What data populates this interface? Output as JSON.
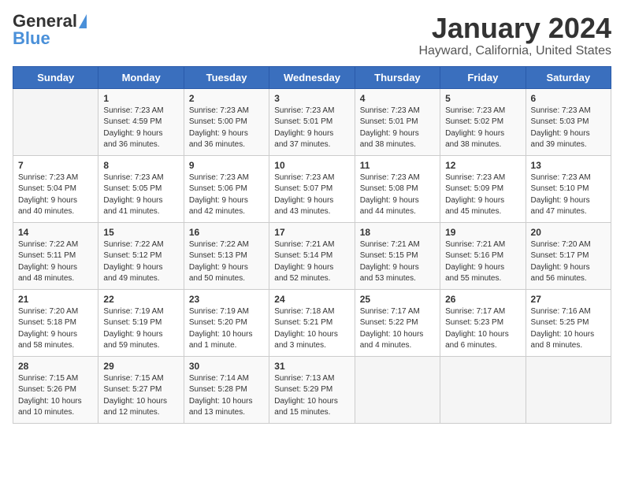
{
  "logo": {
    "general": "General",
    "blue": "Blue"
  },
  "title": "January 2024",
  "subtitle": "Hayward, California, United States",
  "days_header": [
    "Sunday",
    "Monday",
    "Tuesday",
    "Wednesday",
    "Thursday",
    "Friday",
    "Saturday"
  ],
  "weeks": [
    [
      {
        "num": "",
        "info": ""
      },
      {
        "num": "1",
        "info": "Sunrise: 7:23 AM\nSunset: 4:59 PM\nDaylight: 9 hours\nand 36 minutes."
      },
      {
        "num": "2",
        "info": "Sunrise: 7:23 AM\nSunset: 5:00 PM\nDaylight: 9 hours\nand 36 minutes."
      },
      {
        "num": "3",
        "info": "Sunrise: 7:23 AM\nSunset: 5:01 PM\nDaylight: 9 hours\nand 37 minutes."
      },
      {
        "num": "4",
        "info": "Sunrise: 7:23 AM\nSunset: 5:01 PM\nDaylight: 9 hours\nand 38 minutes."
      },
      {
        "num": "5",
        "info": "Sunrise: 7:23 AM\nSunset: 5:02 PM\nDaylight: 9 hours\nand 38 minutes."
      },
      {
        "num": "6",
        "info": "Sunrise: 7:23 AM\nSunset: 5:03 PM\nDaylight: 9 hours\nand 39 minutes."
      }
    ],
    [
      {
        "num": "7",
        "info": "Sunrise: 7:23 AM\nSunset: 5:04 PM\nDaylight: 9 hours\nand 40 minutes."
      },
      {
        "num": "8",
        "info": "Sunrise: 7:23 AM\nSunset: 5:05 PM\nDaylight: 9 hours\nand 41 minutes."
      },
      {
        "num": "9",
        "info": "Sunrise: 7:23 AM\nSunset: 5:06 PM\nDaylight: 9 hours\nand 42 minutes."
      },
      {
        "num": "10",
        "info": "Sunrise: 7:23 AM\nSunset: 5:07 PM\nDaylight: 9 hours\nand 43 minutes."
      },
      {
        "num": "11",
        "info": "Sunrise: 7:23 AM\nSunset: 5:08 PM\nDaylight: 9 hours\nand 44 minutes."
      },
      {
        "num": "12",
        "info": "Sunrise: 7:23 AM\nSunset: 5:09 PM\nDaylight: 9 hours\nand 45 minutes."
      },
      {
        "num": "13",
        "info": "Sunrise: 7:23 AM\nSunset: 5:10 PM\nDaylight: 9 hours\nand 47 minutes."
      }
    ],
    [
      {
        "num": "14",
        "info": "Sunrise: 7:22 AM\nSunset: 5:11 PM\nDaylight: 9 hours\nand 48 minutes."
      },
      {
        "num": "15",
        "info": "Sunrise: 7:22 AM\nSunset: 5:12 PM\nDaylight: 9 hours\nand 49 minutes."
      },
      {
        "num": "16",
        "info": "Sunrise: 7:22 AM\nSunset: 5:13 PM\nDaylight: 9 hours\nand 50 minutes."
      },
      {
        "num": "17",
        "info": "Sunrise: 7:21 AM\nSunset: 5:14 PM\nDaylight: 9 hours\nand 52 minutes."
      },
      {
        "num": "18",
        "info": "Sunrise: 7:21 AM\nSunset: 5:15 PM\nDaylight: 9 hours\nand 53 minutes."
      },
      {
        "num": "19",
        "info": "Sunrise: 7:21 AM\nSunset: 5:16 PM\nDaylight: 9 hours\nand 55 minutes."
      },
      {
        "num": "20",
        "info": "Sunrise: 7:20 AM\nSunset: 5:17 PM\nDaylight: 9 hours\nand 56 minutes."
      }
    ],
    [
      {
        "num": "21",
        "info": "Sunrise: 7:20 AM\nSunset: 5:18 PM\nDaylight: 9 hours\nand 58 minutes."
      },
      {
        "num": "22",
        "info": "Sunrise: 7:19 AM\nSunset: 5:19 PM\nDaylight: 9 hours\nand 59 minutes."
      },
      {
        "num": "23",
        "info": "Sunrise: 7:19 AM\nSunset: 5:20 PM\nDaylight: 10 hours\nand 1 minute."
      },
      {
        "num": "24",
        "info": "Sunrise: 7:18 AM\nSunset: 5:21 PM\nDaylight: 10 hours\nand 3 minutes."
      },
      {
        "num": "25",
        "info": "Sunrise: 7:17 AM\nSunset: 5:22 PM\nDaylight: 10 hours\nand 4 minutes."
      },
      {
        "num": "26",
        "info": "Sunrise: 7:17 AM\nSunset: 5:23 PM\nDaylight: 10 hours\nand 6 minutes."
      },
      {
        "num": "27",
        "info": "Sunrise: 7:16 AM\nSunset: 5:25 PM\nDaylight: 10 hours\nand 8 minutes."
      }
    ],
    [
      {
        "num": "28",
        "info": "Sunrise: 7:15 AM\nSunset: 5:26 PM\nDaylight: 10 hours\nand 10 minutes."
      },
      {
        "num": "29",
        "info": "Sunrise: 7:15 AM\nSunset: 5:27 PM\nDaylight: 10 hours\nand 12 minutes."
      },
      {
        "num": "30",
        "info": "Sunrise: 7:14 AM\nSunset: 5:28 PM\nDaylight: 10 hours\nand 13 minutes."
      },
      {
        "num": "31",
        "info": "Sunrise: 7:13 AM\nSunset: 5:29 PM\nDaylight: 10 hours\nand 15 minutes."
      },
      {
        "num": "",
        "info": ""
      },
      {
        "num": "",
        "info": ""
      },
      {
        "num": "",
        "info": ""
      }
    ]
  ]
}
